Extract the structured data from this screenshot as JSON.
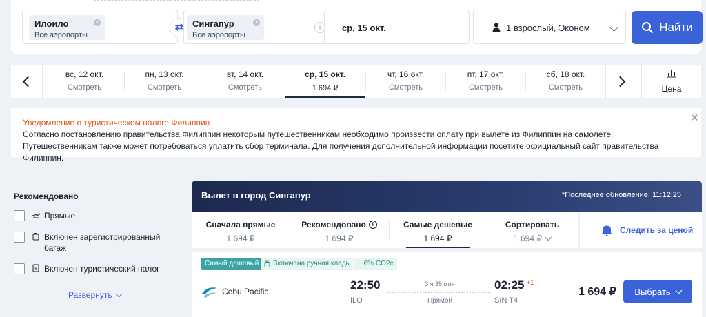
{
  "search": {
    "origin": {
      "city": "Илоило",
      "airports": "Все аэропорты"
    },
    "destination": {
      "city": "Сингапур",
      "airports": "Все аэропорты"
    },
    "date": "ср, 15 окт.",
    "passengers": "1 взрослый, Эконом",
    "search_button": "Найти"
  },
  "date_strip": {
    "days": [
      {
        "day": "вс, 12 окт.",
        "sub": "Смотреть"
      },
      {
        "day": "пн, 13 окт.",
        "sub": "Смотреть"
      },
      {
        "day": "вт, 14 окт.",
        "sub": "Смотреть"
      },
      {
        "day": "ср, 15 окт.",
        "sub": "1 694 ₽"
      },
      {
        "day": "чт, 16 окт.",
        "sub": "Смотреть"
      },
      {
        "day": "пт, 17 окт.",
        "sub": "Смотреть"
      },
      {
        "day": "сб, 18 окт.",
        "sub": "Смотреть"
      }
    ],
    "price_tab": "Цена"
  },
  "notice": {
    "title": "Уведомление о туристическом налоге Филиппин",
    "body": "Согласно постановлению правительства Филиппин некоторым путешественникам необходимо произвести оплату при вылете из Филиппин на самолете. Путешественникам также может потребоваться уплатить сбор терминала. Для получения дополнительной информации посетите официальный сайт правительства Филиппин."
  },
  "filters": {
    "title": "Рекомендовано",
    "items": [
      {
        "label": "Прямые"
      },
      {
        "label": "Включен зарегистрированный багаж"
      },
      {
        "label": "Включен туристический налог"
      }
    ],
    "expand": "Развернуть"
  },
  "results": {
    "title": "Вылет в город Сингапур",
    "last_update": "*Последнее обновление: 11:12:25",
    "sort_tabs": [
      {
        "label": "Сначала прямые",
        "price": "1 694 ₽"
      },
      {
        "label": "Рекомендовано",
        "price": "1 694 ₽"
      },
      {
        "label": "Самые дешевые",
        "price": "1 694 ₽"
      },
      {
        "label": "Сортировать",
        "price": "1 694 ₽"
      }
    ],
    "track_price": "Следить за ценой",
    "flight": {
      "badges": {
        "cheapest": "Самый дешевый",
        "baggage": "Включена ручная кладь",
        "co2": "− 6% CO2e"
      },
      "airline": "Cebu Pacific",
      "departure_time": "22:50",
      "departure_code": "ILO",
      "duration": "3 ч 35 мин",
      "route_type": "Прямой",
      "arrival_time": "02:25",
      "arrival_day_offset": "+1",
      "arrival_code": "SIN T4",
      "price": "1 694 ₽",
      "select_button": "Выбрать"
    }
  },
  "colors": {
    "accent": "#3b63d9",
    "notice_title": "#e4531c",
    "badge_teal": "#3aa3a3"
  }
}
